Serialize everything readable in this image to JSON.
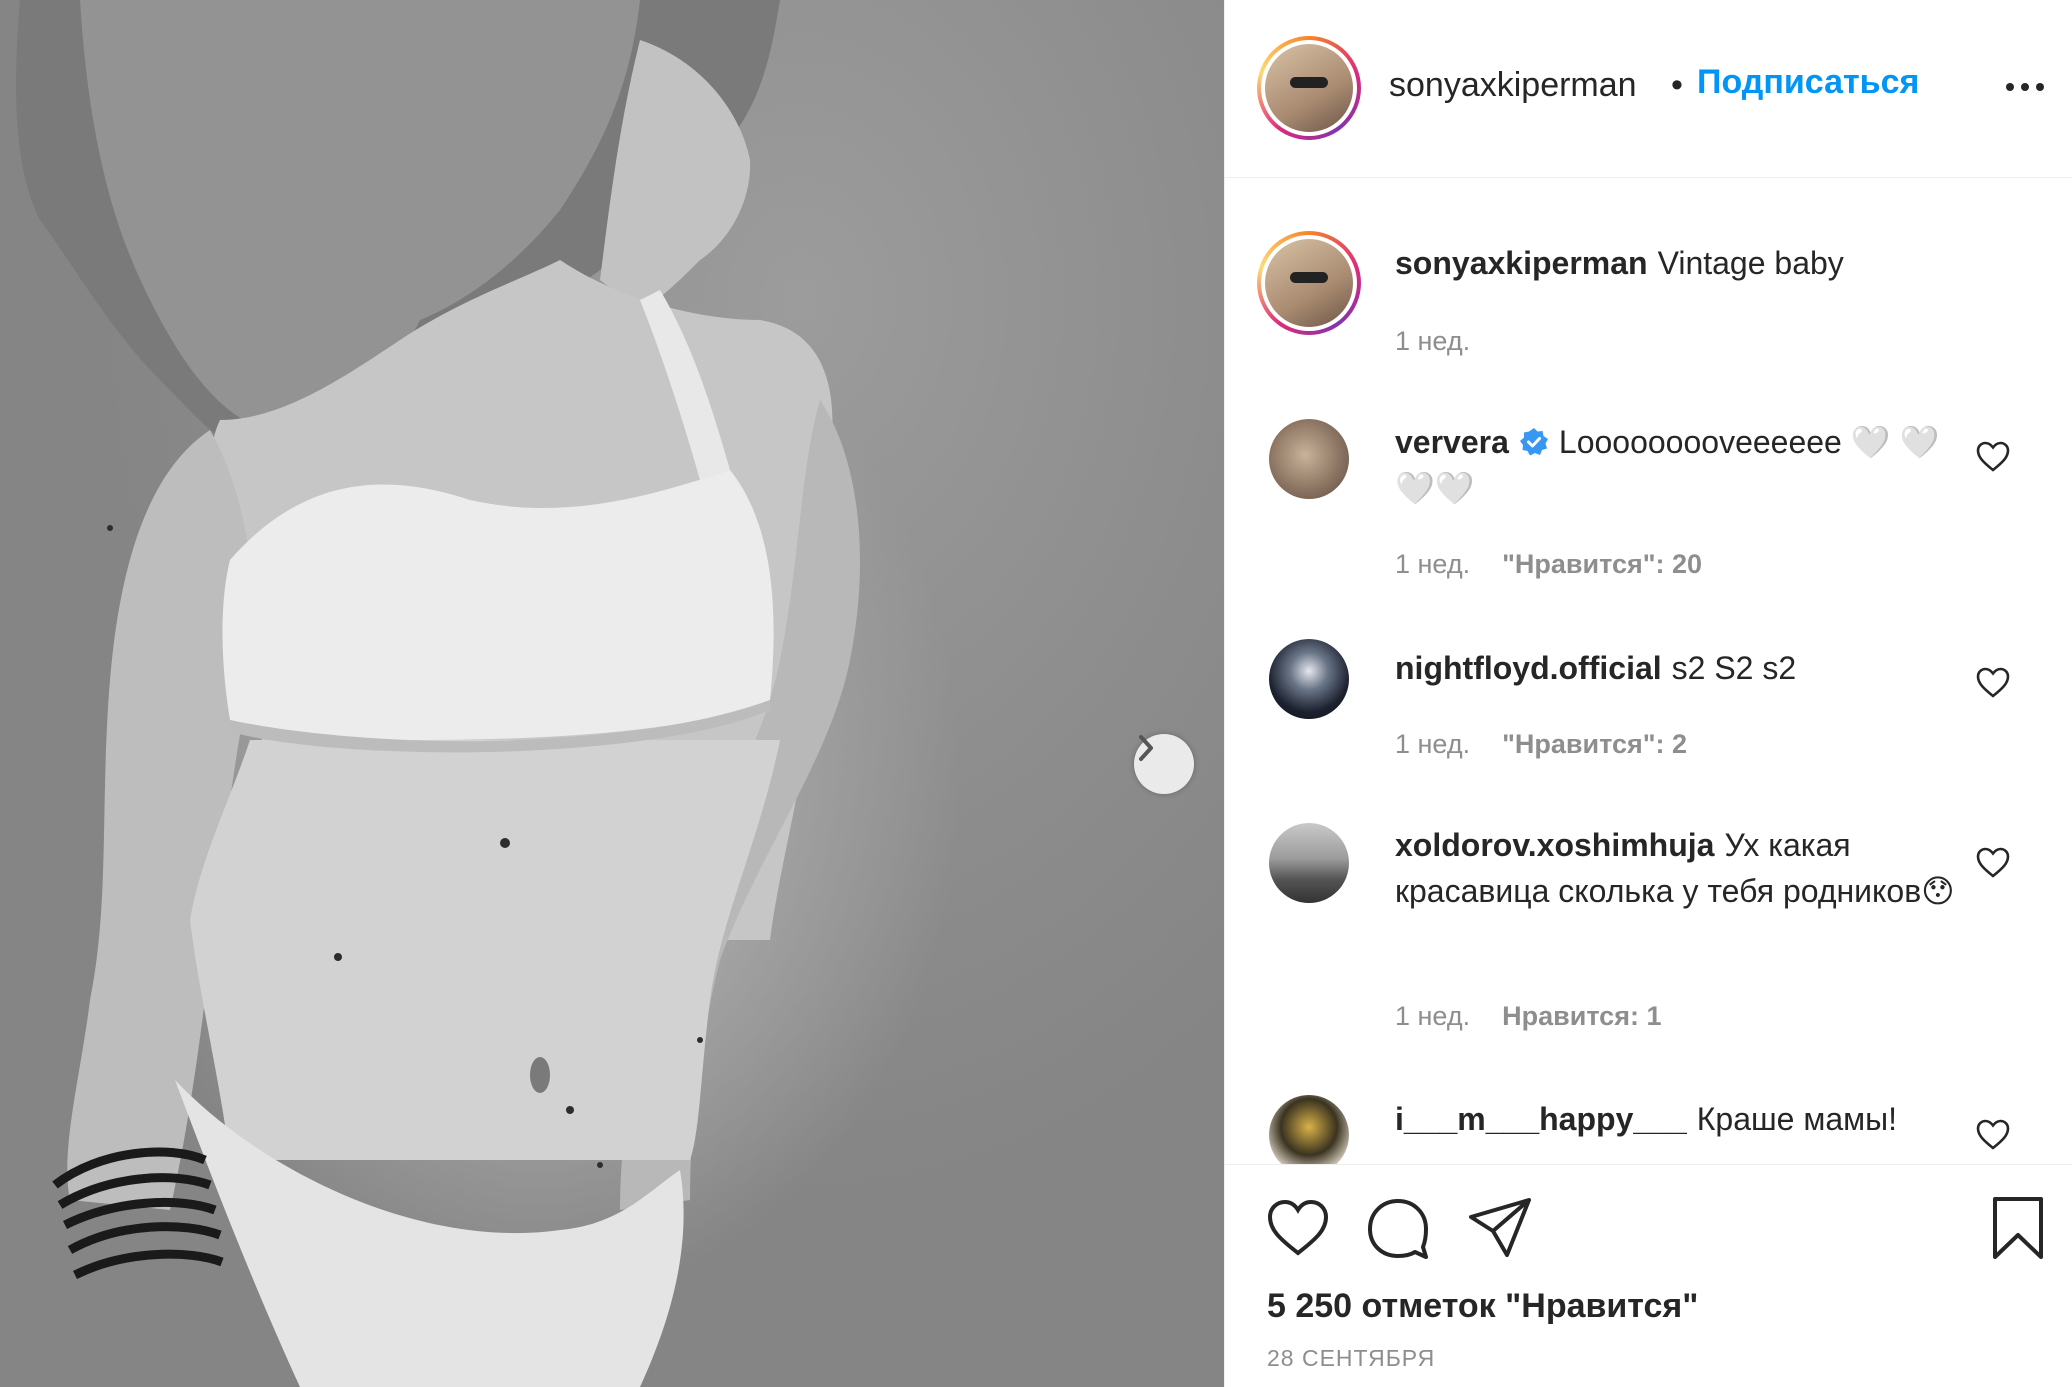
{
  "post": {
    "username": "sonyaxkiperman",
    "separator": "•",
    "follow_label": "Подписаться",
    "more_icon": "more-horizontal-icon"
  },
  "caption": {
    "username": "sonyaxkiperman",
    "text": "Vintage baby",
    "time": "1 нед."
  },
  "comments": [
    {
      "username": "ververa",
      "verified": true,
      "text": "Looooooooveeeeee 🤍 🤍🤍🤍",
      "time": "1 нед.",
      "likes": "\"Нравится\": 20"
    },
    {
      "username": "nightfloyd.official",
      "verified": false,
      "text": "s2 S2 s2",
      "time": "1 нед.",
      "likes": "\"Нравится\": 2"
    },
    {
      "username": "xoldorov.xoshimhuja",
      "verified": false,
      "text": "Ух какая красавица сколька у тебя родников😯",
      "time": "1 нед.",
      "likes": "Нравится: 1"
    },
    {
      "username": "i___m___happy___",
      "verified": false,
      "text": "Краше мамы!",
      "time": "",
      "likes": ""
    }
  ],
  "actions": {
    "like_icon": "heart-icon",
    "comment_icon": "comment-icon",
    "share_icon": "share-icon",
    "save_icon": "bookmark-icon",
    "likes_total": "5 250 отметок \"Нравится\"",
    "date": "28 сентября"
  },
  "colors": {
    "link": "#0095f6",
    "text": "#262626",
    "muted": "#8e8e8e",
    "verified": "#3897f0"
  }
}
